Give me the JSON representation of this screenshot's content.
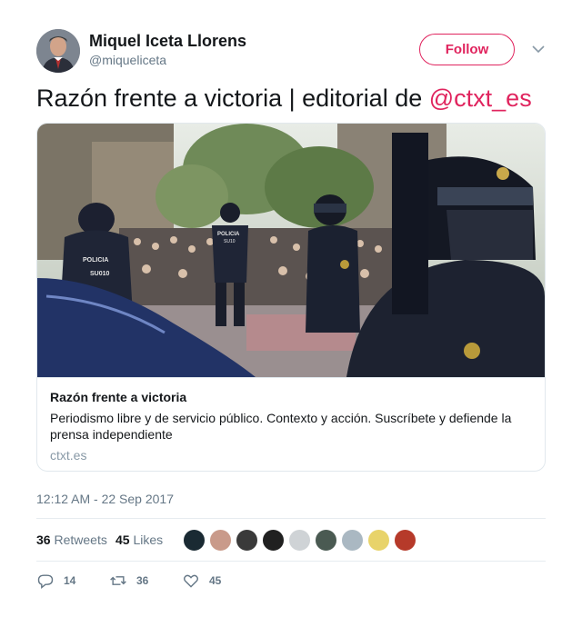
{
  "user": {
    "name": "Miquel Iceta Llorens",
    "handle": "@miqueliceta",
    "follow_label": "Follow"
  },
  "tweet": {
    "text": "Razón frente a victoria | editorial de ",
    "mention": "@ctxt_es"
  },
  "card": {
    "title": "Razón frente a victoria",
    "description": "Periodismo libre y de servicio público. Contexto y acción. Suscríbete y defiende la prensa independiente",
    "domain": "ctxt.es",
    "image_labels": [
      "POLICIA",
      "SU010",
      "POLICIA",
      "SU10"
    ]
  },
  "timestamp": "12:12 AM - 22 Sep 2017",
  "stats": {
    "retweets_count": "36",
    "retweets_label": "Retweets",
    "likes_count": "45",
    "likes_label": "Likes"
  },
  "actions": {
    "reply_count": "14",
    "retweet_count": "36",
    "like_count": "45"
  },
  "colors": {
    "accent": "#e0245e",
    "secondary_text": "#657786",
    "border": "#e1e8ed"
  },
  "icons": [
    "chevron-down-icon",
    "reply-icon",
    "retweet-icon",
    "heart-icon"
  ]
}
